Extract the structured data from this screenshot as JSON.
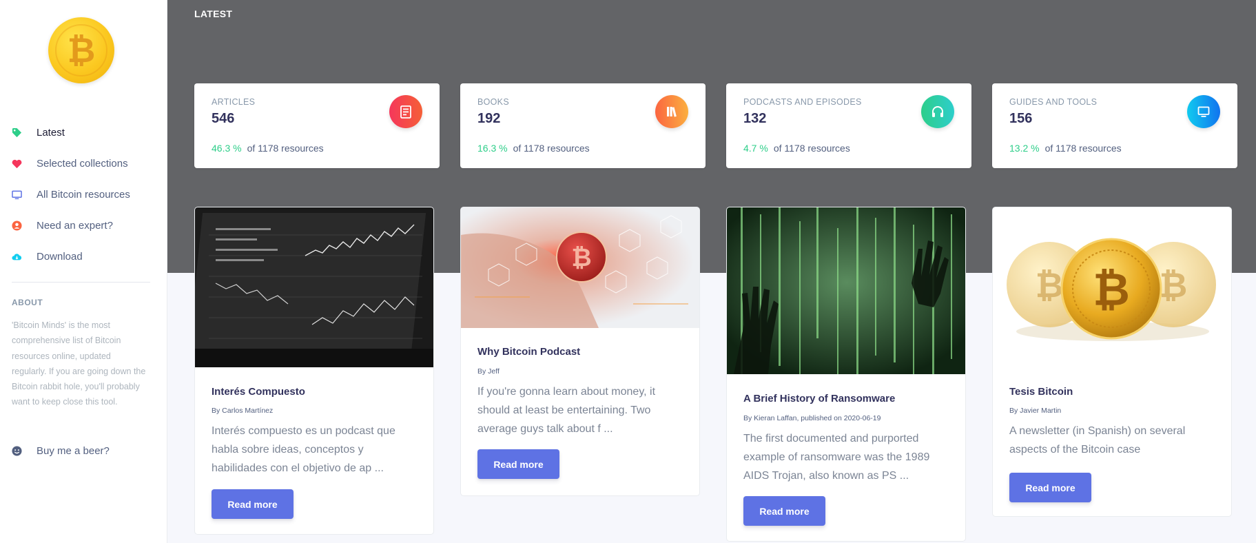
{
  "sidebar": {
    "nav": [
      {
        "label": "Latest",
        "icon": "tag-icon",
        "color": "#2dce89"
      },
      {
        "label": "Selected collections",
        "icon": "heart-icon",
        "color": "#f5365c"
      },
      {
        "label": "All Bitcoin resources",
        "icon": "monitor-icon",
        "color": "#5e72e4"
      },
      {
        "label": "Need an expert?",
        "icon": "user-circle-icon",
        "color": "#fb6340"
      },
      {
        "label": "Download",
        "icon": "cloud-download-icon",
        "color": "#11cdef"
      }
    ],
    "about_title": "ABOUT",
    "about_text": "'Bitcoin Minds' is the most comprehensive list of Bitcoin resources online, updated regularly. If you are going down the Bitcoin rabbit hole, you'll probably want to keep close this tool.",
    "beer_label": "Buy me a beer?"
  },
  "header": {
    "title": "LATEST"
  },
  "stats": [
    {
      "label": "ARTICLES",
      "value": "546",
      "pct": "46.3 %",
      "of": "of 1178 resources",
      "icon": "document-icon",
      "color": "#f5365c"
    },
    {
      "label": "BOOKS",
      "value": "192",
      "pct": "16.3 %",
      "of": "of 1178 resources",
      "icon": "books-icon",
      "color": "#fb6340"
    },
    {
      "label": "PODCASTS AND EPISODES",
      "value": "132",
      "pct": "4.7 %",
      "of": "of 1178 resources",
      "icon": "headphones-icon",
      "color": "#2dce89"
    },
    {
      "label": "GUIDES AND TOOLS",
      "value": "156",
      "pct": "13.2 %",
      "of": "of 1178 resources",
      "icon": "monitor-icon",
      "color": "#11cdef"
    }
  ],
  "cards": [
    {
      "title": "Interés Compuesto",
      "author": "By Carlos Martínez",
      "desc": "Interés compuesto es un podcast que habla sobre ideas, conceptos y habilidades con el objetivo de ap ...",
      "button": "Read more"
    },
    {
      "title": "Why Bitcoin Podcast",
      "author": "By Jeff",
      "desc": "If you're gonna learn about money, it should at least be entertaining. Two average guys talk about f ...",
      "button": "Read more"
    },
    {
      "title": "A Brief History of Ransomware",
      "author": "By Kieran Laffan, published on 2020-06-19",
      "desc": "The first documented and purported example of ransomware was the 1989 AIDS Trojan, also known as PS ...",
      "button": "Read more"
    },
    {
      "title": "Tesis Bitcoin",
      "author": "By Javier Martin",
      "desc": "A newsletter (in Spanish) on several aspects of the Bitcoin case",
      "button": "Read more"
    }
  ]
}
